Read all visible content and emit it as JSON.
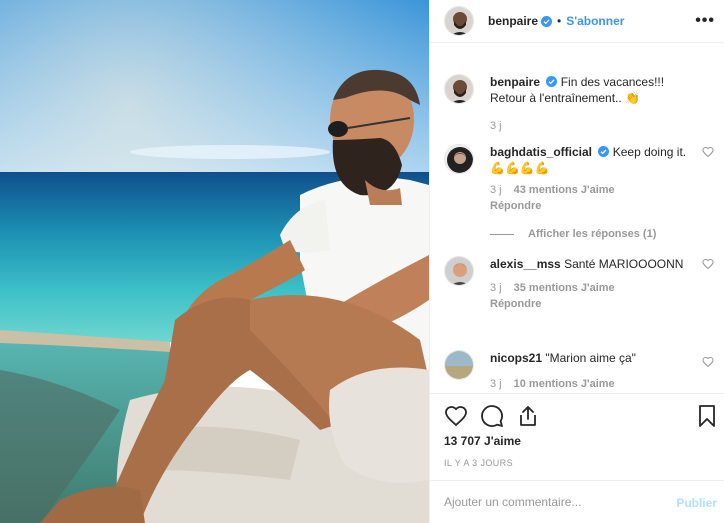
{
  "header": {
    "username": "benpaire",
    "follow_label": "S'abonner",
    "more_label": "•••"
  },
  "caption": {
    "username": "benpaire",
    "text": "Fin des vacances!!! Retour à l'entraînement.. 👏",
    "time": "3 j"
  },
  "comments": [
    {
      "username": "baghdatis_official",
      "verified": true,
      "text": "Keep doing it. 💪💪💪💪",
      "time": "3 j",
      "likes": "43 mentions J'aime",
      "reply": "Répondre",
      "view_replies": "Afficher les réponses (1)"
    },
    {
      "username": "alexis__mss",
      "text": "Santé MARIOOOONN",
      "time": "3 j",
      "likes": "35 mentions J'aime",
      "reply": "Répondre"
    },
    {
      "username": "nicops21",
      "text": "\"Marion aime ça\"",
      "time": "3 j",
      "likes": "10 mentions J'aime"
    }
  ],
  "post": {
    "likes": "13 707 J'aime",
    "time_ago": "IL Y A 3 JOURS"
  },
  "add_comment": {
    "placeholder": "Ajouter un commentaire...",
    "publish_label": "Publier"
  },
  "icons": {
    "like": "heart-icon",
    "comment": "comment-icon",
    "share": "share-icon",
    "save": "bookmark-icon",
    "verified": "verified-badge-icon",
    "more": "more-options-icon"
  },
  "colors": {
    "link_blue": "#3897f0",
    "verified_blue": "#3897f0",
    "muted_text": "#999999",
    "publish_disabled": "#b2dffc",
    "border": "#efefef"
  }
}
